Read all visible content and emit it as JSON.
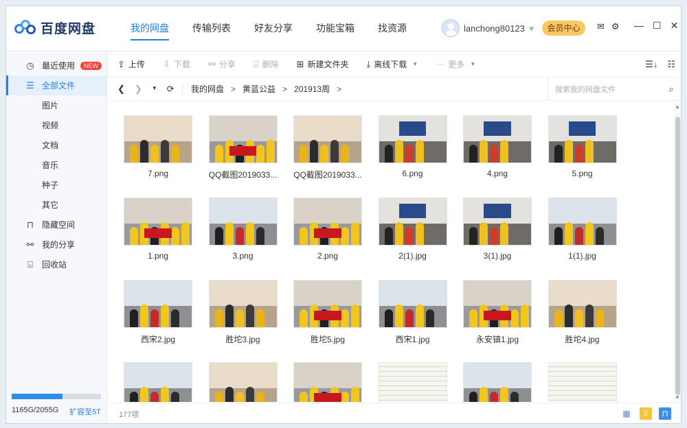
{
  "app": {
    "title": "百度网盘"
  },
  "nav": {
    "tabs": [
      "我的网盘",
      "传输列表",
      "好友分享",
      "功能宝箱",
      "找资源"
    ],
    "active": 0
  },
  "user": {
    "name": "lanchong80123",
    "vip_label": "会员中心"
  },
  "window_controls": {
    "mail": "✉",
    "settings": "⚙",
    "minimize": "—",
    "maximize": "☐",
    "close": "✕"
  },
  "sidebar": {
    "items": [
      {
        "label": "最近使用",
        "icon": "clock-icon",
        "glyph": "◷",
        "badge": "NEW"
      },
      {
        "label": "全部文件",
        "icon": "file-icon",
        "glyph": "☰",
        "active": true
      },
      {
        "label": "图片",
        "sub": true
      },
      {
        "label": "视频",
        "sub": true
      },
      {
        "label": "文档",
        "sub": true
      },
      {
        "label": "音乐",
        "sub": true
      },
      {
        "label": "种子",
        "sub": true
      },
      {
        "label": "其它",
        "sub": true
      },
      {
        "label": "隐藏空间",
        "icon": "lock-icon",
        "glyph": "🔒"
      },
      {
        "label": "我的分享",
        "icon": "share-icon",
        "glyph": "⚯"
      },
      {
        "label": "回收站",
        "icon": "trash-icon",
        "glyph": "🗑"
      }
    ],
    "quota": {
      "text": "1165G/2055G",
      "used_fraction": 0.567,
      "upgrade": "扩容至5T"
    }
  },
  "toolbar": {
    "upload": "上传",
    "download": "下载",
    "share": "分享",
    "delete": "删除",
    "new_folder": "新建文件夹",
    "offline": "离线下载",
    "more": "更多"
  },
  "path": {
    "crumbs": [
      "我的网盘",
      "黄蓝公益",
      "201913周"
    ],
    "search_placeholder": "搜索我的网盘文件"
  },
  "files": [
    {
      "name": "7.png",
      "style": "class"
    },
    {
      "name": "QQ截图2019033...",
      "style": "banner"
    },
    {
      "name": "QQ截图2019033...",
      "style": "class"
    },
    {
      "name": "6.png",
      "style": "screen"
    },
    {
      "name": "4.png",
      "style": "screen"
    },
    {
      "name": "5.png",
      "style": "screen"
    },
    {
      "name": "1.png",
      "style": "banner"
    },
    {
      "name": "3.png",
      "style": "group"
    },
    {
      "name": "2.png",
      "style": "banner"
    },
    {
      "name": "2(1).jpg",
      "style": "screen"
    },
    {
      "name": "3(1).jpg",
      "style": "screen"
    },
    {
      "name": "1(1).jpg",
      "style": "group"
    },
    {
      "name": "西宋2.jpg",
      "style": "group"
    },
    {
      "name": "胜坨3.jpg",
      "style": "class"
    },
    {
      "name": "胜坨5.jpg",
      "style": "banner"
    },
    {
      "name": "西宋1.jpg",
      "style": "group"
    },
    {
      "name": "永安镇1.jpg",
      "style": "banner"
    },
    {
      "name": "胜坨4.jpg",
      "style": "class"
    },
    {
      "name": "",
      "style": "group"
    },
    {
      "name": "",
      "style": "class"
    },
    {
      "name": "",
      "style": "banner"
    },
    {
      "name": "",
      "style": "doc"
    },
    {
      "name": "",
      "style": "group"
    },
    {
      "name": "",
      "style": "doc"
    }
  ],
  "status": {
    "count": "177项"
  }
}
